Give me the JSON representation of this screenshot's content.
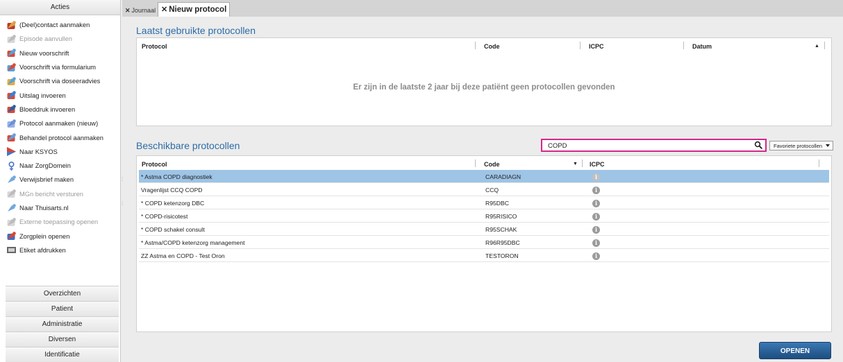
{
  "sidebar": {
    "title": "Acties",
    "items": [
      {
        "label": "(Deel)contact aanmaken",
        "icon": "contact-icon",
        "disabled": false
      },
      {
        "label": "Episode aanvullen",
        "icon": "episode-icon",
        "disabled": true
      },
      {
        "label": "Nieuw voorschrift",
        "icon": "prescription-icon",
        "disabled": false
      },
      {
        "label": "Voorschrift via formularium",
        "icon": "formulary-icon",
        "disabled": false
      },
      {
        "label": "Voorschrift via doseeradvies",
        "icon": "dosage-icon",
        "disabled": false
      },
      {
        "label": "Uitslag invoeren",
        "icon": "result-icon",
        "disabled": false
      },
      {
        "label": "Bloeddruk invoeren",
        "icon": "blood-pressure-icon",
        "disabled": false
      },
      {
        "label": "Protocol aanmaken (nieuw)",
        "icon": "protocol-icon",
        "disabled": false
      },
      {
        "label": "Behandel protocol aanmaken",
        "icon": "treatment-protocol-icon",
        "disabled": false
      },
      {
        "label": "Naar KSYOS",
        "icon": "ksyos-icon",
        "disabled": false
      },
      {
        "label": "Naar ZorgDomein",
        "icon": "zorgdomein-icon",
        "disabled": false
      },
      {
        "label": "Verwijsbrief maken",
        "icon": "referral-icon",
        "disabled": false
      },
      {
        "label": "MGn bericht versturen",
        "icon": "message-icon",
        "disabled": true
      },
      {
        "label": "Naar Thuisarts.nl",
        "icon": "thuisarts-icon",
        "disabled": false
      },
      {
        "label": "Externe toepassing openen",
        "icon": "external-app-icon",
        "disabled": true
      },
      {
        "label": "Zorgplein openen",
        "icon": "zorgplein-icon",
        "disabled": false
      },
      {
        "label": "Etiket afdrukken",
        "icon": "label-print-icon",
        "disabled": false
      }
    ],
    "categories": [
      "Overzichten",
      "Patient",
      "Administratie",
      "Diversen",
      "Identificatie"
    ]
  },
  "tabs": {
    "journaal": "Journaal",
    "active": "Nieuw protocol",
    "close_glyph": "✕"
  },
  "recent": {
    "title": "Laatst gebruikte protocollen",
    "columns": {
      "protocol": "Protocol",
      "code": "Code",
      "icpc": "ICPC",
      "datum": "Datum"
    },
    "sort_glyph": "▲",
    "empty_message": "Er zijn in de laatste 2 jaar bij deze patiënt geen protocollen gevonden"
  },
  "available": {
    "title": "Beschikbare protocollen",
    "search_value": "COPD",
    "filter_label": "Favoriete protocollen",
    "columns": {
      "protocol": "Protocol",
      "code": "Code",
      "icpc": "ICPC"
    },
    "sort_glyph": "▼",
    "rows": [
      {
        "protocol": "* Astma COPD diagnostiek",
        "code": "CARADIAGN",
        "selected": true
      },
      {
        "protocol": "Vragenlijst CCQ COPD",
        "code": "CCQ",
        "selected": false
      },
      {
        "protocol": "* COPD ketenzorg DBC",
        "code": "R95DBC",
        "selected": false
      },
      {
        "protocol": "* COPD-risicotest",
        "code": "R95RISICO",
        "selected": false
      },
      {
        "protocol": "* COPD schakel consult",
        "code": "R95SCHAK",
        "selected": false
      },
      {
        "protocol": "* Astma/COPD ketenzorg management",
        "code": "R96R95DBC",
        "selected": false
      },
      {
        "protocol": "ZZ Astma en COPD - Test Oron",
        "code": "TESTORON",
        "selected": false
      }
    ]
  },
  "actions": {
    "open_label": "OPENEN"
  },
  "colors": {
    "accent": "#2d6ca8",
    "selected_row": "#9ec4e6",
    "search_border": "#d6268c",
    "button": "#1d4d80"
  }
}
